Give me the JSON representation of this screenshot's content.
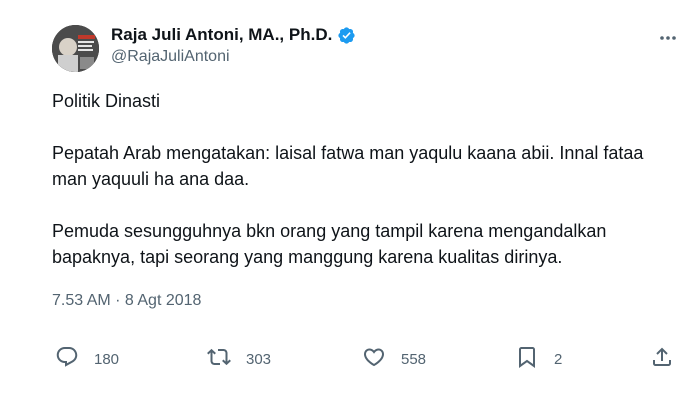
{
  "tweet": {
    "author": {
      "display_name": "Raja Juli Antoni, MA., Ph.D.",
      "handle": "@RajaJuliAntoni",
      "verified_color": "#1d9bf0"
    },
    "paragraphs": [
      "Politik Dinasti",
      "Pepatah Arab mengatakan: laisal fatwa man yaqulu kaana abii. Innal fataa man yaquuli ha ana daa.",
      "Pemuda sesungguhnya bkn orang yang tampil karena mengandalkan bapaknya, tapi seorang yang manggung karena kualitas dirinya."
    ],
    "timestamp": "7.53 AM · 8 Agt 2018",
    "stats": {
      "replies": "180",
      "reposts": "303",
      "likes": "558",
      "bookmarks": "2"
    }
  },
  "icons": {
    "more": "more-icon",
    "reply": "reply-icon",
    "repost": "repost-icon",
    "like": "heart-icon",
    "bookmark": "bookmark-icon",
    "share": "share-icon"
  }
}
